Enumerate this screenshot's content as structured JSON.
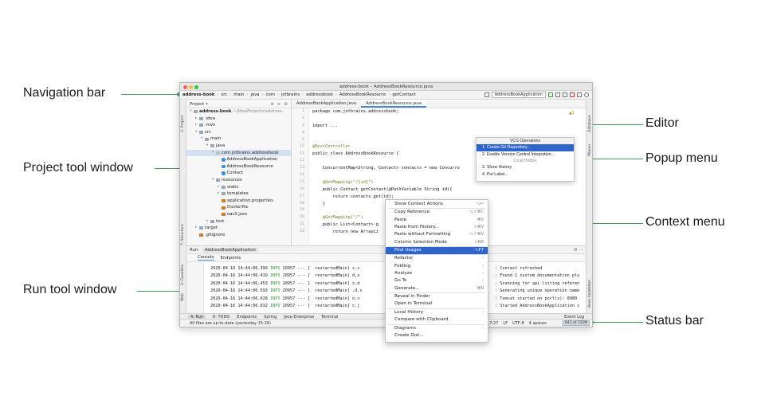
{
  "callouts": {
    "navigation_bar": "Navigation bar",
    "project_tool_window": "Project tool window",
    "run_tool_window": "Run tool window",
    "editor": "Editor",
    "popup_menu": "Popup menu",
    "context_menu": "Context menu",
    "status_bar": "Status bar"
  },
  "colors": {
    "accent_green": "#3f9e57",
    "selection_blue": "#2f65ca"
  },
  "window": {
    "title": "address-book – AddressBookResource.java"
  },
  "navbar": {
    "crumbs": [
      "address-book",
      "src",
      "main",
      "java",
      "com",
      "jetbrains",
      "addressbook",
      "AddressBookResource",
      "getContact"
    ],
    "run_config": "AddressBookApplication"
  },
  "project": {
    "header": "Project",
    "tree": [
      {
        "label": "address-book",
        "extra": "~/IdeaProjects/address-",
        "icon": "folder"
      },
      {
        "label": ".idea",
        "icon": "folder"
      },
      {
        "label": ".mvn",
        "icon": "folder"
      },
      {
        "label": "src",
        "icon": "folder"
      },
      {
        "label": "main",
        "icon": "folder"
      },
      {
        "label": "java",
        "icon": "folder"
      },
      {
        "label": "com.jetbrains.addressbook",
        "icon": "package"
      },
      {
        "label": "AddressBookApplication",
        "icon": "class"
      },
      {
        "label": "AddressBookResource",
        "icon": "class"
      },
      {
        "label": "Contact",
        "icon": "class"
      },
      {
        "label": "resources",
        "icon": "folder"
      },
      {
        "label": "static",
        "icon": "folder"
      },
      {
        "label": "templates",
        "icon": "folder"
      },
      {
        "label": "application.properties",
        "icon": "file"
      },
      {
        "label": "Dockerfile",
        "icon": "file"
      },
      {
        "label": "oas3.json",
        "icon": "file"
      },
      {
        "label": "test",
        "icon": "folder"
      },
      {
        "label": "target",
        "icon": "folder"
      },
      {
        "label": ".gitignore",
        "icon": "file"
      }
    ]
  },
  "editor": {
    "tabs": [
      "AddressBookApplication.java",
      "AddressBookResource.java"
    ],
    "warning": "▲1",
    "line_numbers": [
      "1",
      "2",
      "3",
      "4",
      "5",
      "10",
      "11",
      "12",
      "13",
      "14",
      "15",
      "16",
      "17",
      "18",
      "19",
      "20",
      "21",
      "22"
    ],
    "lines": [
      "package com.jetbrains.addressbook;",
      "",
      "import ...",
      "",
      "",
      "@RestController",
      "public class AddressBookResource {",
      "",
      "    ConcurrentMap<String, Contact> contacts = new Concurre",
      "",
      "    @GetMapping(\"/{id}\")",
      "    public Contact getContact(@PathVariable String id){",
      "        return contacts.get(id);",
      "    }",
      "",
      "    @GetMapping(\"/\")",
      "    public List<Contact> g",
      "        return new ArrayLi"
    ]
  },
  "vcs_popup": {
    "title": "VCS Operations",
    "items": [
      "1. Create Git Repository...",
      "2. Enable Version Control Integration..."
    ],
    "section": "Local History",
    "items2": [
      "3. Show History",
      "4. Put Label..."
    ]
  },
  "run": {
    "label": "Run:",
    "config": "AddressBookApplication",
    "tabs": [
      "Console",
      "Endpoints"
    ],
    "logs": [
      {
        "ts": "2020-04-16 14:44:06.399",
        "lvl": "INFO",
        "pid": "20957 --- [  restartedMain] c.c",
        "msg": ": Context refreshed"
      },
      {
        "ts": "2020-04-16 14:44:06.419",
        "lvl": "INFO",
        "pid": "20957 --- [  restartedMain] d.s",
        "msg": ": Found 1 custom documentation plu"
      },
      {
        "ts": "2020-04-16 14:44:06.453",
        "lvl": "INFO",
        "pid": "20957 --- [  restartedMain] s.d",
        "msg": ": Scanning for api listing referen"
      },
      {
        "ts": "2020-04-16 14:44:06.593",
        "lvl": "INFO",
        "pid": "20957 --- [  restartedMain] .d.s",
        "msg": ": Generating unique operation name"
      },
      {
        "ts": "2020-04-16 14:44:06.628",
        "lvl": "INFO",
        "pid": "20957 --- [  restartedMain] o.s",
        "msg": ": Tomcat started on port(s): 8080"
      },
      {
        "ts": "2020-04-16 14:44:06.632",
        "lvl": "INFO",
        "pid": "20957 --- [  restartedMain] c.j",
        "msg": ": Started AddressBookApplication i"
      }
    ]
  },
  "bottom_tabs": [
    "4: Run",
    "6: TODO",
    "Endpoints",
    "Spring",
    "Java Enterprise",
    "Terminal"
  ],
  "event_log": "Event Log",
  "status": {
    "message": "All files are up-to-date (yesterday 15:26)",
    "position": "17:27",
    "line_sep": "LF",
    "encoding": "UTF-8",
    "indent": "4 spaces",
    "memory": "643 of 725M"
  },
  "context_menu": {
    "items": [
      {
        "label": "Show Context Actions",
        "shortcut": "⌥↩"
      },
      {
        "label": "Copy Reference",
        "shortcut": "⌥⇧⌘C"
      },
      {
        "label": "Paste",
        "shortcut": "⌘V"
      },
      {
        "label": "Paste from History...",
        "shortcut": "⇧⌘V"
      },
      {
        "label": "Paste without Formatting",
        "shortcut": "⌥⇧⌘V"
      },
      {
        "label": "Column Selection Mode",
        "shortcut": "⇧⌘8"
      },
      {
        "label": "Find Usages",
        "shortcut": "⌥F7"
      },
      {
        "label": "Refactor",
        "shortcut": "›"
      },
      {
        "label": "Folding",
        "shortcut": "›"
      },
      {
        "label": "Analyze",
        "shortcut": "›"
      },
      {
        "label": "Go To",
        "shortcut": "›"
      },
      {
        "label": "Generate...",
        "shortcut": "⌘N"
      },
      {
        "label": "Reveal in Finder",
        "shortcut": ""
      },
      {
        "label": "Open in Terminal",
        "shortcut": ""
      },
      {
        "label": "Local History",
        "shortcut": "›"
      },
      {
        "label": "Compare with Clipboard",
        "shortcut": ""
      },
      {
        "label": "Diagrams",
        "shortcut": "›"
      },
      {
        "label": "Create Gist...",
        "shortcut": ""
      }
    ],
    "selected_index": 6
  },
  "side_labels": {
    "project": "1: Project",
    "structure": "7: Structure",
    "favorites": "2: Favorites",
    "web": "Web",
    "database": "Database",
    "maven": "Maven",
    "bean_validation": "Bean Validation"
  }
}
